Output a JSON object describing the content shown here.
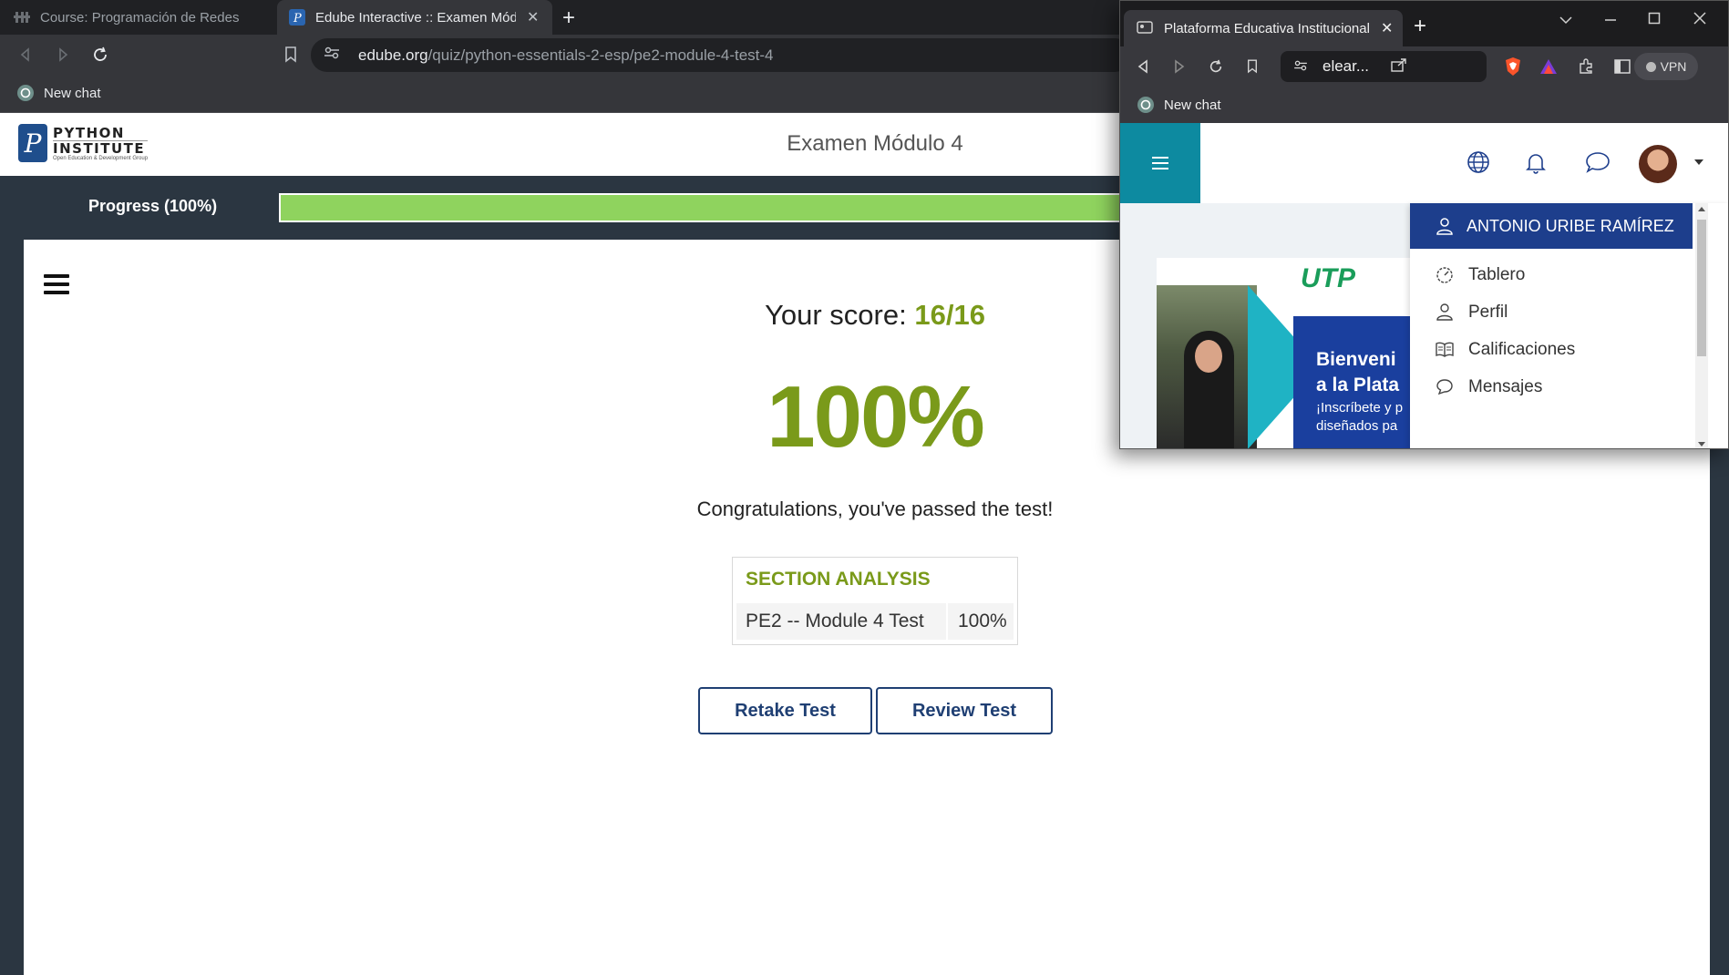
{
  "left_browser": {
    "tabs": [
      {
        "title": "Course: Programación de Redes",
        "active": false
      },
      {
        "title": "Edube Interactive :: Examen Módulo 4",
        "active": true
      }
    ],
    "url_host": "edube.org",
    "url_path": "/quiz/python-essentials-2-esp/pe2-module-4-test-4",
    "bookmark": "New chat"
  },
  "page": {
    "logo_line1": "PYTHON",
    "logo_line2": "INSTITUTE",
    "logo_line3": "Open Education & Development Group",
    "title": "Examen Módulo 4",
    "progress_label": "Progress (100%)",
    "progress_value": 100,
    "score_label": "Your score:",
    "score_value": "16/16",
    "percent": "100%",
    "congrats": "Congratulations, you've passed the test!",
    "section_title": "SECTION ANALYSIS",
    "section_name": "PE2 -- Module 4 Test",
    "section_pct": "100%",
    "retake_label": "Retake Test",
    "review_label": "Review Test"
  },
  "right_browser": {
    "tab_title": "Plataforma Educativa Institucional",
    "url": "elear...",
    "vpn": "VPN",
    "bookmark": "New chat",
    "banner_line1": "Bienveni",
    "banner_line2": "a la Plata",
    "banner_line3": "¡Inscríbete y p",
    "banner_line4": "diseñados pa",
    "banner_logo": "UTP",
    "dropdown": {
      "user": "ANTONIO URIBE RAMÍREZ",
      "items": [
        "Tablero",
        "Perfil",
        "Calificaciones",
        "Mensajes"
      ]
    }
  },
  "colors": {
    "accent_green": "#7a9a1a",
    "progress_green": "#8fd35e",
    "navy": "#1d3e8c",
    "teal": "#0d8aa0"
  }
}
